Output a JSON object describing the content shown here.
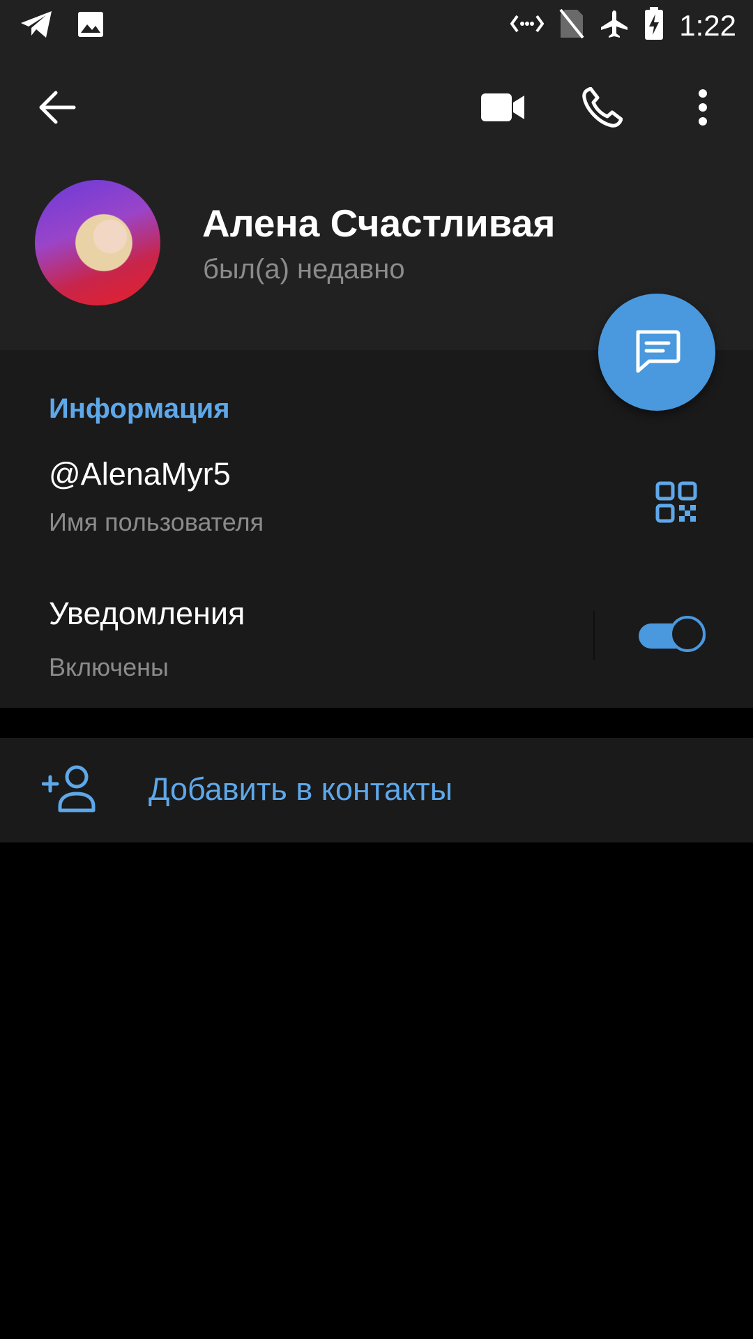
{
  "status_bar": {
    "time": "1:22",
    "left_icons": [
      "telegram-icon",
      "image-icon"
    ],
    "right_icons": [
      "data-transfer-icon",
      "no-sim-icon",
      "airplane-mode-icon",
      "battery-charging-icon"
    ]
  },
  "app_bar": {
    "actions": [
      "back-arrow-icon",
      "video-call-icon",
      "phone-call-icon",
      "more-vert-icon"
    ]
  },
  "profile": {
    "name": "Алена Счастливая",
    "last_seen": "был(а) недавно"
  },
  "info": {
    "section_title": "Информация",
    "username": "@AlenaMyr5",
    "username_label": "Имя пользователя",
    "notifications_title": "Уведомления",
    "notifications_status": "Включены",
    "notifications_enabled": true
  },
  "actions": {
    "add_contact_label": "Добавить в контакты"
  },
  "colors": {
    "accent": "#5ea8ea",
    "fab": "#4a98de",
    "header_bg": "#212121",
    "section_bg": "#1a1a1a",
    "page_bg": "#000000",
    "secondary_text": "#8b8b8b"
  }
}
